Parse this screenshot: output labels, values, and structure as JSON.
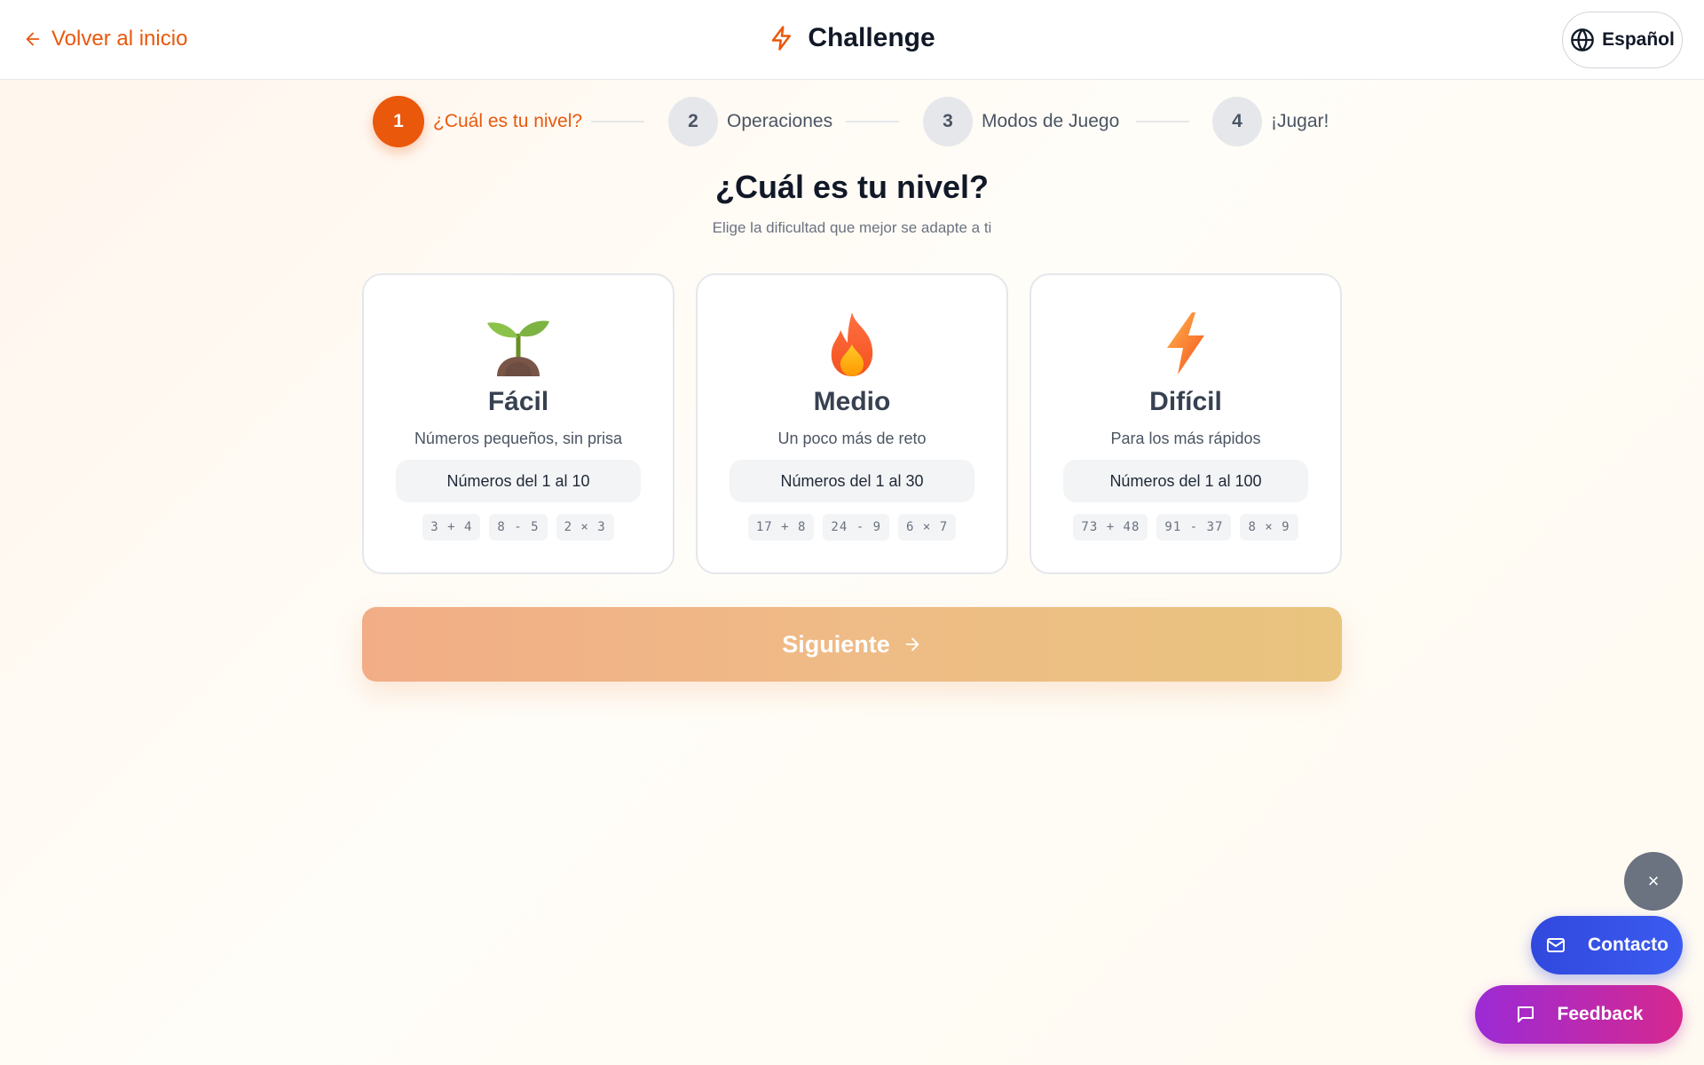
{
  "header": {
    "back_label": "Volver al inicio",
    "brand_title": "Challenge",
    "language_label": "Español"
  },
  "stepper": [
    {
      "number": "1",
      "label": "¿Cuál es tu nivel?",
      "active": true
    },
    {
      "number": "2",
      "label": "Operaciones",
      "active": false
    },
    {
      "number": "3",
      "label": "Modos de Juego",
      "active": false
    },
    {
      "number": "4",
      "label": "¡Jugar!",
      "active": false
    }
  ],
  "main": {
    "title": "¿Cuál es tu nivel?",
    "subtitle": "Elige la dificultad que mejor se adapte a ti"
  },
  "levels": [
    {
      "icon": "seedling-icon",
      "name": "Fácil",
      "description": "Números pequeños, sin prisa",
      "range": "Números del 1 al 10",
      "examples": [
        "3 + 4",
        "8 - 5",
        "2 × 3"
      ]
    },
    {
      "icon": "fire-icon",
      "name": "Medio",
      "description": "Un poco más de reto",
      "range": "Números del 1 al 30",
      "examples": [
        "17 + 8",
        "24 - 9",
        "6 × 7"
      ]
    },
    {
      "icon": "lightning-icon",
      "name": "Difícil",
      "description": "Para los más rápidos",
      "range": "Números del 1 al 100",
      "examples": [
        "73 + 48",
        "91 - 37",
        "8 × 9"
      ]
    }
  ],
  "next_label": "Siguiente",
  "floating": {
    "close_label": "×",
    "contact_label": "Contacto",
    "feedback_label": "Feedback"
  },
  "colors": {
    "accent": "#ea580c",
    "contact": "#3148dd",
    "feedback_start": "#9b2bd6",
    "feedback_end": "#d6288f"
  }
}
